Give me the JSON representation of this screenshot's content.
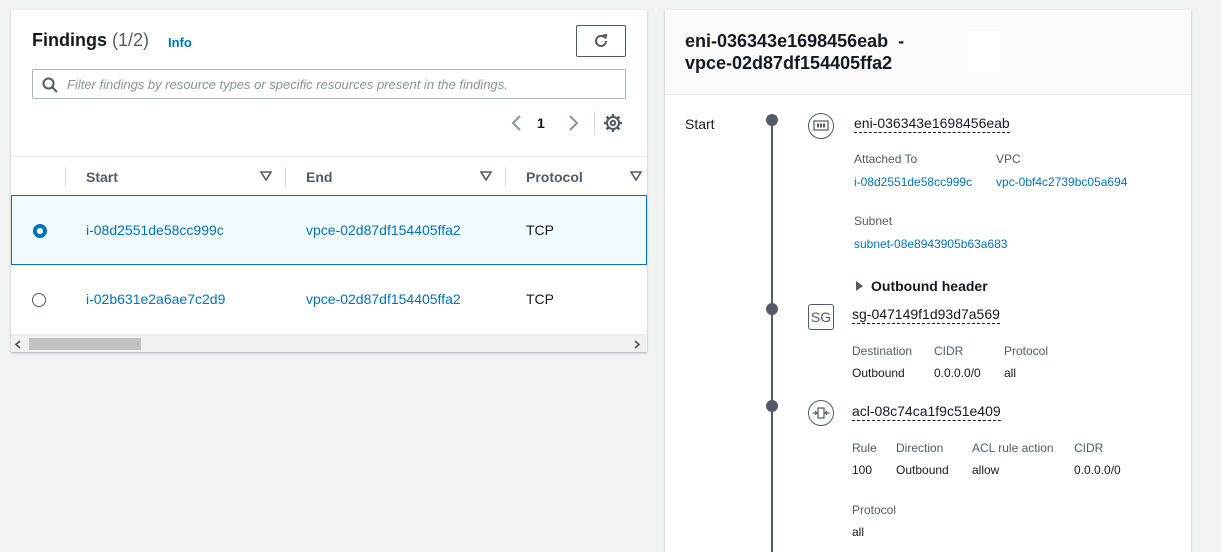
{
  "findings": {
    "title": "Findings",
    "count": "(1/2)",
    "info": "Info",
    "search_placeholder": "Filter findings by resource types or specific resources present in the findings.",
    "page_number": "1",
    "columns": [
      "Start",
      "End",
      "Protocol"
    ],
    "rows": [
      {
        "start": "i-08d2551de58cc999c",
        "end": "vpce-02d87df154405ffa2",
        "protocol": "TCP",
        "selected": true
      },
      {
        "start": "i-02b631e2a6ae7c2d9",
        "end": "vpce-02d87df154405ffa2",
        "protocol": "TCP",
        "selected": false
      }
    ]
  },
  "detail": {
    "title_line1": "eni-036343e1698456eab  -",
    "title_line2": "vpce-02d87df154405ffa2",
    "start_label": "Start",
    "eni": {
      "id": "eni-036343e1698456eab",
      "attached_to_key": "Attached To",
      "attached_to_val": "i-08d2551de58cc999c",
      "vpc_key": "VPC",
      "vpc_val": "vpc-0bf4c2739bc05a694",
      "subnet_key": "Subnet",
      "subnet_val": "subnet-08e8943905b63a683",
      "outbound_header": "Outbound header"
    },
    "sg": {
      "icon_text": "SG",
      "id": "sg-047149f1d93d7a569",
      "destination_key": "Destination",
      "destination_val": "Outbound",
      "cidr_key": "CIDR",
      "cidr_val": "0.0.0.0/0",
      "protocol_key": "Protocol",
      "protocol_val": "all"
    },
    "acl": {
      "id": "acl-08c74ca1f9c51e409",
      "rule_key": "Rule",
      "rule_val": "100",
      "direction_key": "Direction",
      "direction_val": "Outbound",
      "action_key": "ACL rule action",
      "action_val": "allow",
      "cidr_key": "CIDR",
      "cidr_val": "0.0.0.0/0",
      "protocol_key": "Protocol",
      "protocol_val": "all"
    }
  },
  "colors": {
    "link": "#0073bb",
    "selected_row_bg": "#f1faff",
    "text": "#16191f",
    "muted": "#545b64"
  }
}
